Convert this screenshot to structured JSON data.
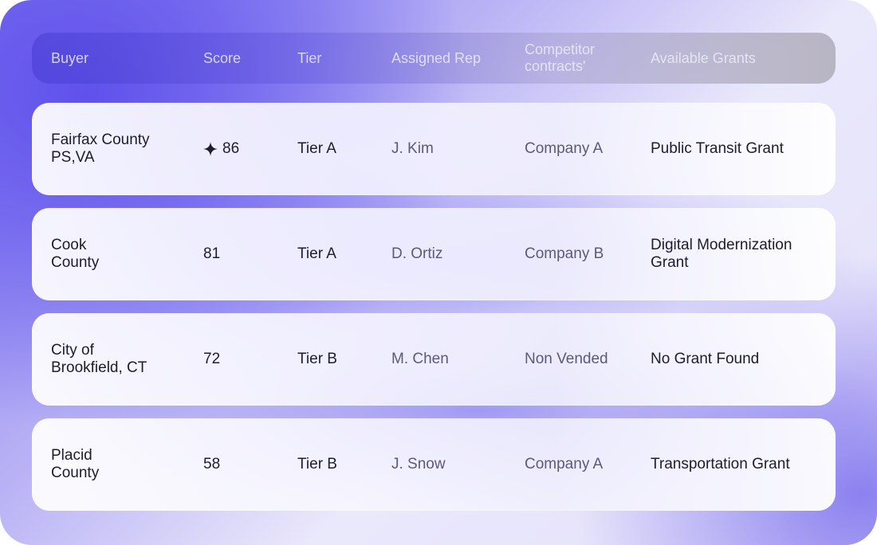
{
  "table": {
    "headers": {
      "buyer": "Buyer",
      "score": "Score",
      "tier": "Tier",
      "rep": "Assigned Rep",
      "competitor": "Competitor contracts'",
      "grants": "Available Grants"
    },
    "rows": [
      {
        "buyer": "Fairfax County\nPS,VA",
        "score": "86",
        "score_icon": "sparkle-icon",
        "tier": "Tier A",
        "rep": "J. Kim",
        "competitor": "Company A",
        "grant": "Public Transit Grant"
      },
      {
        "buyer": "Cook\nCounty",
        "score": "81",
        "tier": "Tier A",
        "rep": "D. Ortiz",
        "competitor": "Company B",
        "grant": "Digital Modernization\nGrant"
      },
      {
        "buyer": "City of\nBrookfield, CT",
        "score": "72",
        "tier": "Tier B",
        "rep": "M. Chen",
        "competitor": "Non Vended",
        "grant": "No Grant Found"
      },
      {
        "buyer": "Placid\nCounty",
        "score": "58",
        "tier": "Tier B",
        "rep": "J. Snow",
        "competitor": "Company A",
        "grant": "Transportation Grant"
      }
    ]
  },
  "colors": {
    "accent": "#5c4eeb",
    "text_primary": "#1d1d2b",
    "text_secondary": "#5c5a78"
  }
}
